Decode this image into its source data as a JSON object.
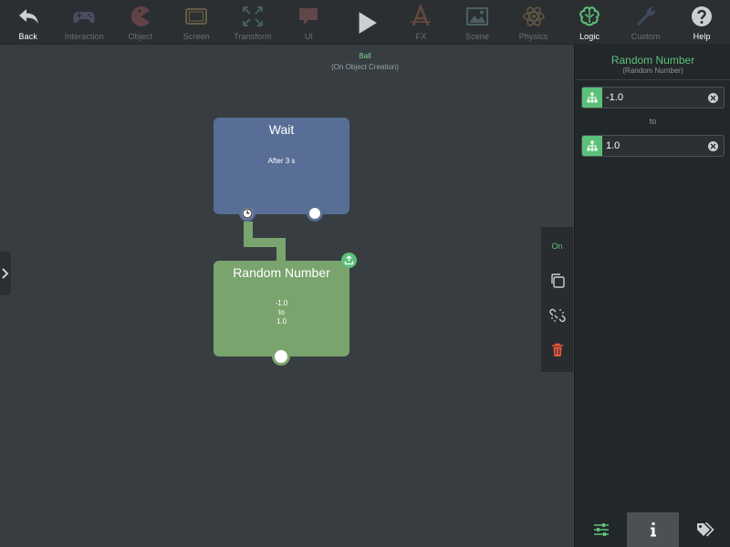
{
  "toolbar": {
    "items": [
      {
        "label": "Back",
        "icon": "back-arrow-icon",
        "color": "#c9cfd2",
        "dim": false
      },
      {
        "label": "Interaction",
        "icon": "gamepad-icon",
        "color": "#9a8fd6",
        "dim": true
      },
      {
        "label": "Object",
        "icon": "pacman-icon",
        "color": "#e0707a",
        "dim": true
      },
      {
        "label": "Screen",
        "icon": "tablet-icon",
        "color": "#e8c770",
        "dim": true
      },
      {
        "label": "Transform",
        "icon": "expand-arrows-icon",
        "color": "#7ecbc4",
        "dim": true
      },
      {
        "label": "UI",
        "icon": "speech-bubble-icon",
        "color": "#e07b7b",
        "dim": true
      },
      {
        "label": "",
        "icon": "play-icon",
        "color": "#c9cfd2",
        "dim": false
      },
      {
        "label": "FX",
        "icon": "fx-icon",
        "color": "#ef8a5a",
        "dim": true
      },
      {
        "label": "Scene",
        "icon": "landscape-icon",
        "color": "#8fd1d8",
        "dim": true
      },
      {
        "label": "Physics",
        "icon": "atom-icon",
        "color": "#e8b26c",
        "dim": true
      },
      {
        "label": "Logic",
        "icon": "brain-icon",
        "color": "#5cc07a",
        "dim": false
      },
      {
        "label": "Custom",
        "icon": "wrench-icon",
        "color": "#6f8ec9",
        "dim": true
      },
      {
        "label": "Help",
        "icon": "help-icon",
        "color": "#c9cfd2",
        "dim": false
      }
    ]
  },
  "context": {
    "object_name": "Ball",
    "trigger": "(On Object Creation)"
  },
  "nodes": {
    "wait": {
      "title": "Wait",
      "body": "After 3 s",
      "color": "#586e96"
    },
    "random": {
      "title": "Random Number",
      "body_lines": [
        "-1.0",
        "to",
        "1.0"
      ],
      "color": "#7aa46e"
    }
  },
  "tools": {
    "on_label": "On",
    "delete_color": "#e8553f"
  },
  "panel": {
    "title": "Random Number",
    "subtitle": "(Random Number)",
    "field1_value": "-1.0",
    "to_label": "to",
    "field2_value": "1.0",
    "accent": "#5cc07a"
  }
}
